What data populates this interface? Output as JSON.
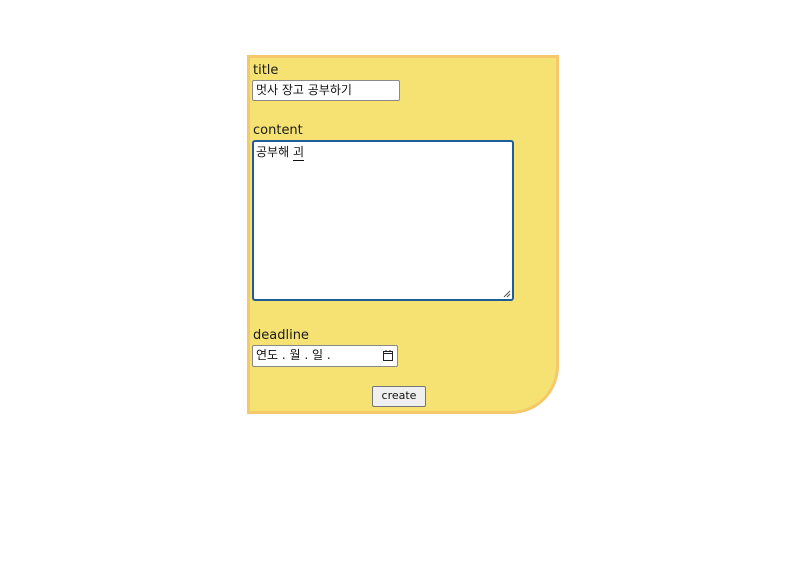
{
  "form": {
    "title_label": "title",
    "title_value": "멋사 장고 공부하기",
    "content_label": "content",
    "content_value": "공부해 ",
    "content_caret_char": "괴",
    "deadline_label": "deadline",
    "deadline_placeholder": "연도 .  월 .  일 .",
    "create_label": "create"
  },
  "colors": {
    "card_background": "#f5e272",
    "card_border": "#f5c96a",
    "textarea_focus_border": "#1f5d99"
  },
  "icons": {
    "calendar": "calendar-icon",
    "resize": "resize-handle-icon"
  }
}
